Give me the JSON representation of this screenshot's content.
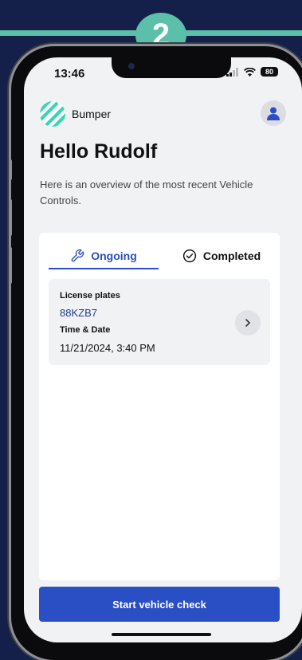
{
  "step_badge": "2",
  "status_bar": {
    "time": "13:46",
    "battery": "80"
  },
  "brand": {
    "name": "Bumper",
    "logo_color": "#37d4b6"
  },
  "greeting": "Hello Rudolf",
  "overview_text": "Here is an overview of the most recent Vehicle Controls.",
  "tabs": [
    {
      "label": "Ongoing",
      "icon": "wrench-icon",
      "active": true
    },
    {
      "label": "Completed",
      "icon": "check-circle-icon",
      "active": false
    }
  ],
  "vehicle_card": {
    "plates_label": "License plates",
    "plate": "88KZB7",
    "time_label": "Time & Date",
    "datetime": "11/21/2024, 3:40 PM"
  },
  "start_button_label": "Start vehicle check",
  "colors": {
    "primary": "#2a4fc4",
    "accent": "#5bbfa9",
    "background": "#14204a"
  }
}
